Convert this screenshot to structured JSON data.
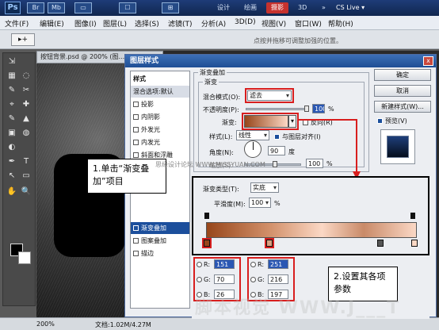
{
  "topbar": {
    "logo": "Ps",
    "icons": [
      "Br",
      "Mb",
      "▭",
      "☐",
      "⊞"
    ],
    "workspace_tabs": [
      "设计",
      "绘画",
      "摄影",
      "3D"
    ],
    "more": "»",
    "cs_live": "CS Live ▾"
  },
  "menubar": [
    "文件(F)",
    "编辑(E)",
    "图像(I)",
    "图层(L)",
    "选择(S)",
    "滤镜(T)",
    "3D(D)",
    "分析(A)",
    "3D(D)",
    "视图(V)",
    "窗口(W)",
    "帮助(H)"
  ],
  "options_bar": {
    "tool": "▸+",
    "hint": "点按并拖移可调整加强的位置。"
  },
  "toolbox": {
    "tools": [
      "⇲",
      "▦",
      "◌",
      "✎",
      "✂",
      "⌖",
      "✚",
      "✎",
      "▲",
      "▣",
      "◍",
      "◐",
      "✒",
      "T",
      "↖",
      "▭",
      "✋",
      "🔍"
    ]
  },
  "document": {
    "tab_title": "按钮背景.psd @ 200% (图..."
  },
  "status": {
    "zoom": "200%",
    "doc_size": "文档:1.02M/4.27M"
  },
  "dialog": {
    "title": "图层样式",
    "close": "x",
    "style_list_header": "样式",
    "style_items": [
      {
        "label": "混合选项:默认",
        "checkbox": false,
        "selected": false
      },
      {
        "label": "投影",
        "checkbox": true,
        "selected": false
      },
      {
        "label": "内阴影",
        "checkbox": true,
        "selected": false
      },
      {
        "label": "外发光",
        "checkbox": true,
        "selected": false
      },
      {
        "label": "内发光",
        "checkbox": true,
        "selected": false
      },
      {
        "label": "斜面和浮雕",
        "checkbox": true,
        "selected": false
      },
      {
        "label": "渐变叠加",
        "checkbox": true,
        "selected": true
      },
      {
        "label": "图案叠加",
        "checkbox": true,
        "selected": false
      },
      {
        "label": "描边",
        "checkbox": true,
        "selected": false
      }
    ],
    "section_title": "渐变叠加",
    "group_title": "渐变",
    "blend_mode_label": "混合模式(O):",
    "blend_mode_value": "滤去",
    "opacity_label": "不透明度(P):",
    "opacity_value": "100",
    "percent": "%",
    "gradient_label": "渐变:",
    "reverse_label": "反向(R)",
    "style_label": "样式(L):",
    "style_value": "线性",
    "align_label": "与图层对齐(I)",
    "angle_label": "角度(N):",
    "angle_value": "90",
    "degree": "度",
    "scale_label": "缩放(S):",
    "scale_value": "100",
    "buttons": [
      "确定",
      "取消",
      "新建样式(W)...",
      "预览(V)"
    ],
    "preview_checked": true
  },
  "gradient_editor": {
    "type_label": "渐变类型(T):",
    "type_value": "实底",
    "smoothness_label": "平滑度(M):",
    "smoothness_value": "100",
    "percent": "%"
  },
  "color1": {
    "r_label": "R:",
    "g_label": "G:",
    "b_label": "B:",
    "r": "151",
    "g": "70",
    "b": "26",
    "hex": "#97461a"
  },
  "color2": {
    "r_label": "R:",
    "g_label": "G:",
    "b_label": "B:",
    "r": "251",
    "g": "216",
    "b": "197",
    "hex": "#fbd8c5"
  },
  "callouts": {
    "step1": "1.单击“渐变叠加”项目",
    "step2": "2.设置其各项参数"
  },
  "watermarks": {
    "small": "思缘设计论坛 WWW.MISSYUAN.COM",
    "big": "脚本视觉 WWW.J___T"
  },
  "colors": {
    "annotation_red": "#d81e1e",
    "selection_blue": "#1c4f9c",
    "title_blue": "#2a5aa6"
  }
}
